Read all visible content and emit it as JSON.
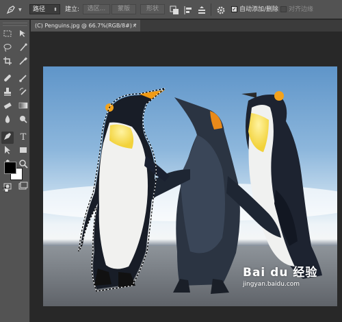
{
  "options_bar": {
    "tool_icon": "pen-tool-icon",
    "mode_select": "路径",
    "make_label": "建立:",
    "selection_button": "选区...",
    "mask_button": "蒙版",
    "shape_button": "形状",
    "path_ops_icon": "path-operations-icon",
    "path_align_icon": "path-alignment-icon",
    "path_arrange_icon": "path-arrangement-icon",
    "settings_icon": "gear-icon",
    "auto_add_delete": {
      "label": "自动添加/删除",
      "checked": true
    },
    "align_edges": {
      "label": "对齐边缘",
      "checked": false
    }
  },
  "document_tab": {
    "title": "(C) Penguins.jpg @ 66.7%(RGB/8#) *",
    "close": "×"
  },
  "toolbar": {
    "tools": [
      {
        "name": "move-tool-icon",
        "glyph": "▸✛"
      },
      {
        "name": "marquee-tool-icon",
        "glyph": "⬚"
      },
      {
        "name": "artboard-tool-icon",
        "glyph": "⇲"
      },
      {
        "name": "lasso-tool-icon",
        "glyph": "◌"
      },
      {
        "name": "quick-selection-tool-icon",
        "glyph": "✎"
      },
      {
        "name": "crop-tool-icon",
        "glyph": "⌗"
      },
      {
        "name": "eyedropper-tool-icon",
        "glyph": "⁄"
      },
      {
        "name": "healing-brush-tool-icon",
        "glyph": "✚"
      },
      {
        "name": "brush-tool-icon",
        "glyph": "∕"
      },
      {
        "name": "clone-stamp-tool-icon",
        "glyph": "⊥"
      },
      {
        "name": "history-brush-tool-icon",
        "glyph": "↺"
      },
      {
        "name": "eraser-tool-icon",
        "glyph": "◨"
      },
      {
        "name": "gradient-tool-icon",
        "glyph": "▤"
      },
      {
        "name": "blur-tool-icon",
        "glyph": "💧"
      },
      {
        "name": "dodge-tool-icon",
        "glyph": "●"
      },
      {
        "name": "pen-tool-icon",
        "glyph": "✒"
      },
      {
        "name": "type-tool-icon",
        "glyph": "T"
      },
      {
        "name": "path-selection-tool-icon",
        "glyph": "▶"
      },
      {
        "name": "rectangle-tool-icon",
        "glyph": "▭"
      },
      {
        "name": "hand-tool-icon",
        "glyph": "✋"
      },
      {
        "name": "zoom-tool-icon",
        "glyph": "🔍"
      }
    ],
    "foreground_color": "#000000",
    "background_color": "#ffffff",
    "quick_mask_icon": "quick-mask-icon",
    "screen_mode_icon": "screen-mode-icon"
  },
  "watermark": {
    "main": "Bai du 经验",
    "sub": "jingyan.baidu.com"
  }
}
